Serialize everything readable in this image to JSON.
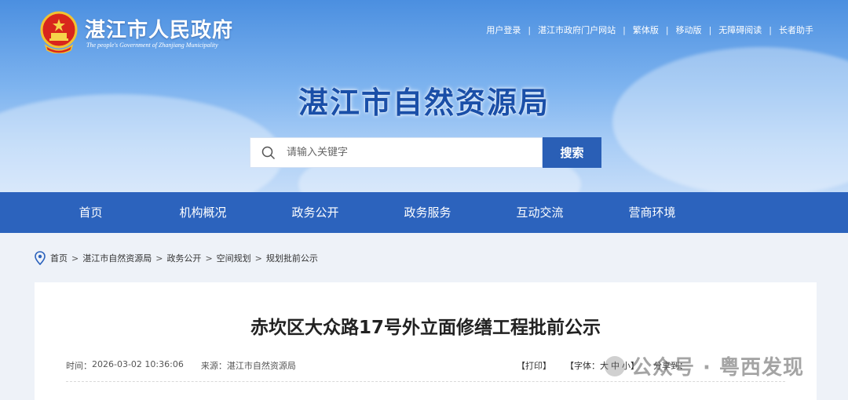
{
  "header": {
    "gov_title": "湛江市人民政府",
    "gov_subtitle": "The people's Government of Zhanjiang Municipality",
    "bureau_title": "湛江市自然资源局",
    "top_links": [
      "用户登录",
      "湛江市政府门户网站",
      "繁体版",
      "移动版",
      "无障碍阅读",
      "长者助手"
    ],
    "top_link_separator": "|"
  },
  "search": {
    "placeholder": "请输入关键字",
    "button_label": "搜索"
  },
  "nav": [
    "首页",
    "机构概况",
    "政务公开",
    "政务服务",
    "互动交流",
    "营商环境"
  ],
  "breadcrumb": {
    "items": [
      "首页",
      "湛江市自然资源局",
      "政务公开",
      "空间规划",
      "规划批前公示"
    ],
    "separator": ">"
  },
  "article": {
    "title": "赤坎区大众路17号外立面修缮工程批前公示",
    "time_label": "时间：",
    "time_value": "2026-03-02 10:36:06",
    "source_label": "来源：",
    "source_value": "湛江市自然资源局",
    "print": "【打印】",
    "font_size_label": "【字体：",
    "font_large": "大",
    "font_medium": "中",
    "font_small": "小】",
    "share_label": "分享到："
  },
  "watermark": "公众号 · 粤西发现",
  "colors": {
    "nav_bg": "#2c63bd",
    "search_button": "#2a5fb6",
    "bureau_title": "#1a4fa8"
  }
}
